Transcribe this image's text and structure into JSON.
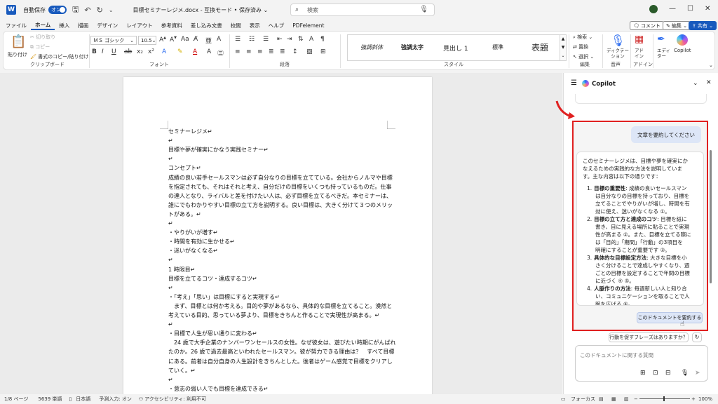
{
  "titlebar": {
    "autosave_label": "自動保存",
    "autosave_state": "オン",
    "doc_title": "目標セミナーレジメ.docx  -  互換モード • 保存済み ⌄",
    "search_placeholder": "検索"
  },
  "menu": {
    "tabs": [
      "ファイル",
      "ホーム",
      "挿入",
      "描画",
      "デザイン",
      "レイアウト",
      "参考資料",
      "差し込み文書",
      "校閲",
      "表示",
      "ヘルプ",
      "PDFelement"
    ],
    "active": "ホーム",
    "comment_label": "コメント",
    "edit_label": "編集 ⌄",
    "share_label": "共有 ⌄"
  },
  "ribbon": {
    "clipboard": {
      "paste": "貼り付け",
      "cut": "切り取り",
      "copy": "コピー",
      "format_painter": "書式のコピー/貼り付け",
      "label": "クリップボード"
    },
    "font": {
      "name": "ＭＳ ゴシック",
      "size": "10.5",
      "label": "フォント"
    },
    "paragraph": {
      "label": "段落"
    },
    "styles": {
      "items": [
        "強調斜体",
        "強調太字",
        "見出し 1",
        "標準",
        "表題"
      ],
      "label": "スタイル"
    },
    "editing": {
      "search": "検索 ⌄",
      "replace": "置換",
      "select": "選択 ⌄",
      "label": "編集"
    },
    "voice": {
      "dictate": "ディクテーション",
      "label": "音声"
    },
    "addin": {
      "addin": "アドイン",
      "label": "アドイン"
    },
    "editor": {
      "label": "エディター"
    },
    "copilot": {
      "label": "Copilot"
    }
  },
  "document": {
    "lines": [
      "セミナーレジメ↵",
      "↵",
      "目標や夢が確実にかなう実践セミナー↵",
      "↵",
      "コンセプト↵",
      "成績の良い若手セールスマンは必ず自分なりの目標を立てている。会社からノルマや目標",
      "を指定されても、それはそれと考え、自分だけの目標をいくつも持っているものだ。仕事",
      "の達人となり、ライバルと差を付けたい人は、必ず目標を立てるべきだ。本セミナーは、",
      "誰にでもわかりやすい目標の立て方を説明する。良い目標は、大きく分けて３つのメリッ",
      "トがある。↵",
      "↵",
      "・やりがいが増す↵",
      "・時間を有効に生かせる↵",
      "・迷いがなくなる↵",
      "↵",
      "1 時限目↵",
      "目標を立てるコツ・達成するコツ↵",
      "↵",
      "・「考え」「思い」は目標にすると実現する↵",
      "　まず、目標とは何か考える。目的や夢があるなら、具体的な目標を立てること。漠然と",
      "考えている目的、思っている夢より、目標をきちんと作ることで実現性が高まる。↵",
      "↵",
      "・目標で人生が思い通りに変わる↵",
      "　24 歳で大手企業のナンバーワンセールスの女性。なぜ彼女は、遊びたい時期にがんばれ",
      "たのか。26 歳で過去最高といわれたセールスマン。彼が努力できる理由は？　すべて目標",
      "にある。前者は自分自身の人生設計をきちんとした。後者はゲーム感覚で目標をクリアし",
      "ていく。↵",
      "↵",
      "・意志の弱い人でも目標を達成できる↵"
    ]
  },
  "copilot": {
    "title": "Copilot",
    "user_message": "文章を要約してください",
    "response_intro": [
      "このセミナーレジメは、目標や夢を確実にか",
      "なえるための実践的な方法を説明していま",
      "す。主な内容は以下の通りです："
    ],
    "response_items": [
      {
        "num": "1.",
        "title": "目標の重要性",
        "lines": [
          ": 成績の良いセールスマン",
          "は自分なりの目標を持っており、目標を",
          "立てることでやりがいが増し、時間を有",
          "効に使え、迷いがなくなる ①。"
        ]
      },
      {
        "num": "2.",
        "title": "目標の立て方と達成のコツ",
        "lines": [
          ": 目標を紙に",
          "書き、目に見える場所に貼ることで実現",
          "性が高まる ②。また、目標を立てる際に",
          "は「目的」「期間」「行動」の3項目を",
          "明確にすることが重要です ③。"
        ]
      },
      {
        "num": "3.",
        "title": "具体的な目標設定方法",
        "lines": [
          ": 大きな目標を小",
          "さく分けることで達成しやすくなり、週",
          "ごとの目標を設定することで年間の目標",
          "に近づく ④ ⑤。"
        ]
      },
      {
        "num": "4.",
        "title": "人脈作りの方法",
        "lines": [
          ": 毎週新しい人と知り合",
          "い、コミュニケーションを取ることで人",
          "脈を広げる ⑥。"
        ]
      }
    ],
    "summary_chip": "このドキュメントを要約する",
    "suggestion_chip": "行動を促すフレーズはありますか？",
    "input_placeholder": "このドキュメントに関する質問"
  },
  "status": {
    "page": "1/8 ページ",
    "words": "5639 単語",
    "lang": "日本語",
    "predict": "予測入力: オン",
    "accessibility": "アクセシビリティ: 利用不可",
    "focus": "フォーカス",
    "zoom": "100%"
  },
  "colors": {
    "accent": "#185abd",
    "highlight": "#e02020"
  }
}
